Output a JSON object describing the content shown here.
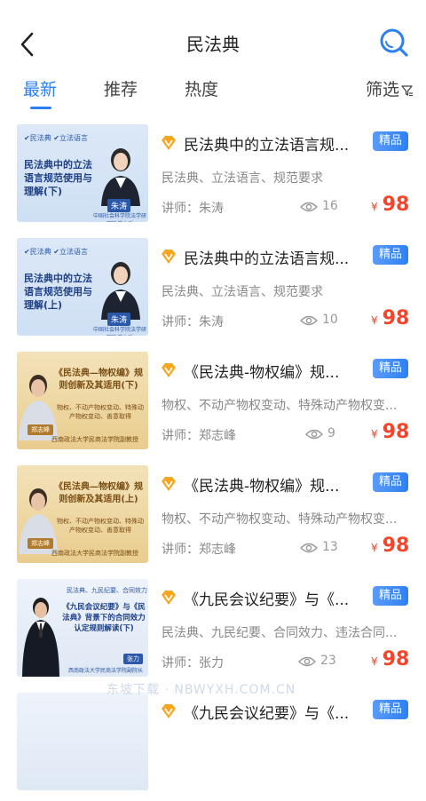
{
  "header": {
    "title": "民法典",
    "back_icon": "chevron-left-icon",
    "search_icon": "search-icon"
  },
  "tabs": [
    {
      "label": "最新",
      "active": true
    },
    {
      "label": "推荐",
      "active": false
    },
    {
      "label": "热度",
      "active": false
    }
  ],
  "filter": {
    "label": "筛选",
    "icon": "filter-icon"
  },
  "colors": {
    "accent": "#2f7ff4",
    "price": "#f2452b",
    "vip": "#f5a623"
  },
  "items": [
    {
      "title": "民法典中的立法语言规...",
      "badge": "精品",
      "tags": "民法典、立法语言、规范要求",
      "lecturer": "讲师：朱涛",
      "views": "16",
      "yen": "¥",
      "price": "98",
      "thumb": {
        "tags": "✔民法典 ✔立法语言",
        "title": "民法典中的立法语言规范使用与理解(下)",
        "name": "朱涛",
        "foot": "中国社会科学院法学研究所博士后"
      }
    },
    {
      "title": "民法典中的立法语言规...",
      "badge": "精品",
      "tags": "民法典、立法语言、规范要求",
      "lecturer": "讲师：朱涛",
      "views": "10",
      "yen": "¥",
      "price": "98",
      "thumb": {
        "tags": "✔民法典 ✔立法语言",
        "title": "民法典中的立法语言规范使用与理解(上)",
        "name": "朱涛",
        "foot": "中国社会科学院法学研究所博士后"
      }
    },
    {
      "title": "《民法典-物权编》规...",
      "badge": "精品",
      "tags": "物权、不动产物权变动、特殊动产物权变...",
      "lecturer": "讲师：郑志峰",
      "views": "9",
      "yen": "¥",
      "price": "98",
      "thumb": {
        "title": "《民法典—物权编》规则创新及其适用(下)",
        "sub": "物权、不动产物权变动、特殊动产物权变动、善意取得",
        "name": "郑志峰",
        "foot": "西南政法大学民商法学院副教授"
      }
    },
    {
      "title": "《民法典-物权编》规...",
      "badge": "精品",
      "tags": "物权、不动产物权变动、特殊动产物权变...",
      "lecturer": "讲师：郑志峰",
      "views": "13",
      "yen": "¥",
      "price": "98",
      "thumb": {
        "title": "《民法典—物权编》规则创新及其适用(上)",
        "sub": "物权、不动产物权变动、特殊动产物权变动、善意取得",
        "name": "郑志峰",
        "foot": "西南政法大学民商法学院副教授"
      }
    },
    {
      "title": "《九民会议纪要》与《...",
      "badge": "精品",
      "tags": "民法典、九民纪要、合同效力、违法合同...",
      "lecturer": "讲师：张力",
      "views": "23",
      "yen": "¥",
      "price": "98",
      "thumb": {
        "tags": "民法典、九民纪要、合同效力",
        "title": "《九民会议纪要》与《民法典》背景下的合同效力认定规则解读(下)",
        "name": "张力",
        "foot": "西南政法大学民商法学院副院长"
      }
    },
    {
      "title": "《九民会议纪要》与《...",
      "badge": "精品"
    }
  ],
  "watermark": "东坡下载 · NBWYXH.COM.CN"
}
